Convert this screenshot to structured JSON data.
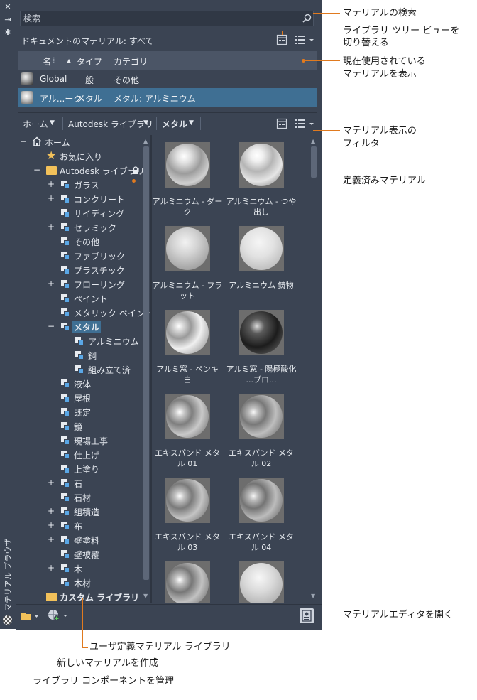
{
  "window": {
    "title": "マテリアル ブラウザ",
    "close_glyph": "✕",
    "pin_glyph": "⇥",
    "settings_glyph": "✱"
  },
  "search": {
    "placeholder": "検索"
  },
  "document": {
    "title": "ドキュメントのマテリアル: すべて",
    "columns": [
      "名",
      "タイプ",
      "カテゴリ"
    ],
    "rows": [
      {
        "name": "Global",
        "type": "一般",
        "category": "その他"
      },
      {
        "name": "アル...ーク",
        "type": "メタル",
        "category": "メタル: アルミニウム"
      }
    ]
  },
  "library_toolbar": {
    "home": "ホーム",
    "library": "Autodesk ライブラリ",
    "category": "メタル"
  },
  "tree": {
    "home": "ホーム",
    "favorites": "お気に入り",
    "autodesk_library": "Autodesk ライブラリ",
    "items": [
      "ガラス",
      "コンクリート",
      "サイディング",
      "セラミック",
      "その他",
      "ファブリック",
      "プラスチック",
      "フローリング",
      "ペイント",
      "メタリック ペイント",
      "メタル",
      "アルミニウム",
      "鋼",
      "組み立て済",
      "液体",
      "屋根",
      "既定",
      "鏡",
      "現場工事",
      "仕上げ",
      "上塗り",
      "石",
      "石材",
      "組積造",
      "布",
      "壁塗料",
      "壁被覆",
      "木",
      "木材"
    ],
    "custom_library": "カスタム ライブラリ"
  },
  "materials": [
    {
      "name": "アルミニウム - ダーク"
    },
    {
      "name": "アルミニウム - つや出し"
    },
    {
      "name": "アルミニウム - フラット"
    },
    {
      "name": "アルミニウム 鋳物"
    },
    {
      "name": "アルミ窓 - ペンキ 白"
    },
    {
      "name": "アルミ窓 - 陽極酸化 ...ブロ..."
    },
    {
      "name": "エキスパンド メタル 01"
    },
    {
      "name": "エキスパンド メタル 02"
    },
    {
      "name": "エキスパンド メタル 03"
    },
    {
      "name": "エキスパンド メタル 04"
    }
  ],
  "callouts": {
    "search": "マテリアルの検索",
    "toggle_view_1": "ライブラリ ツリー ビューを",
    "toggle_view_2": "切り替える",
    "in_use_1": "現在使用されている",
    "in_use_2": "マテリアルを表示",
    "filter_1": "マテリアル表示の",
    "filter_2": "フィルタ",
    "predefined": "定義済みマテリアル",
    "open_editor": "マテリアルエディタを開く",
    "user_library": "ユーザ定義マテリアル ライブラリ",
    "create_new": "新しいマテリアルを作成",
    "manage_components": "ライブラリ コンポーネントを管理"
  },
  "colors": {
    "panel": "#3b4453",
    "selection": "#3f6f93",
    "callout": "#e07a1f",
    "folder": "#f2c15a",
    "library_icon": "#5aa7e6"
  }
}
